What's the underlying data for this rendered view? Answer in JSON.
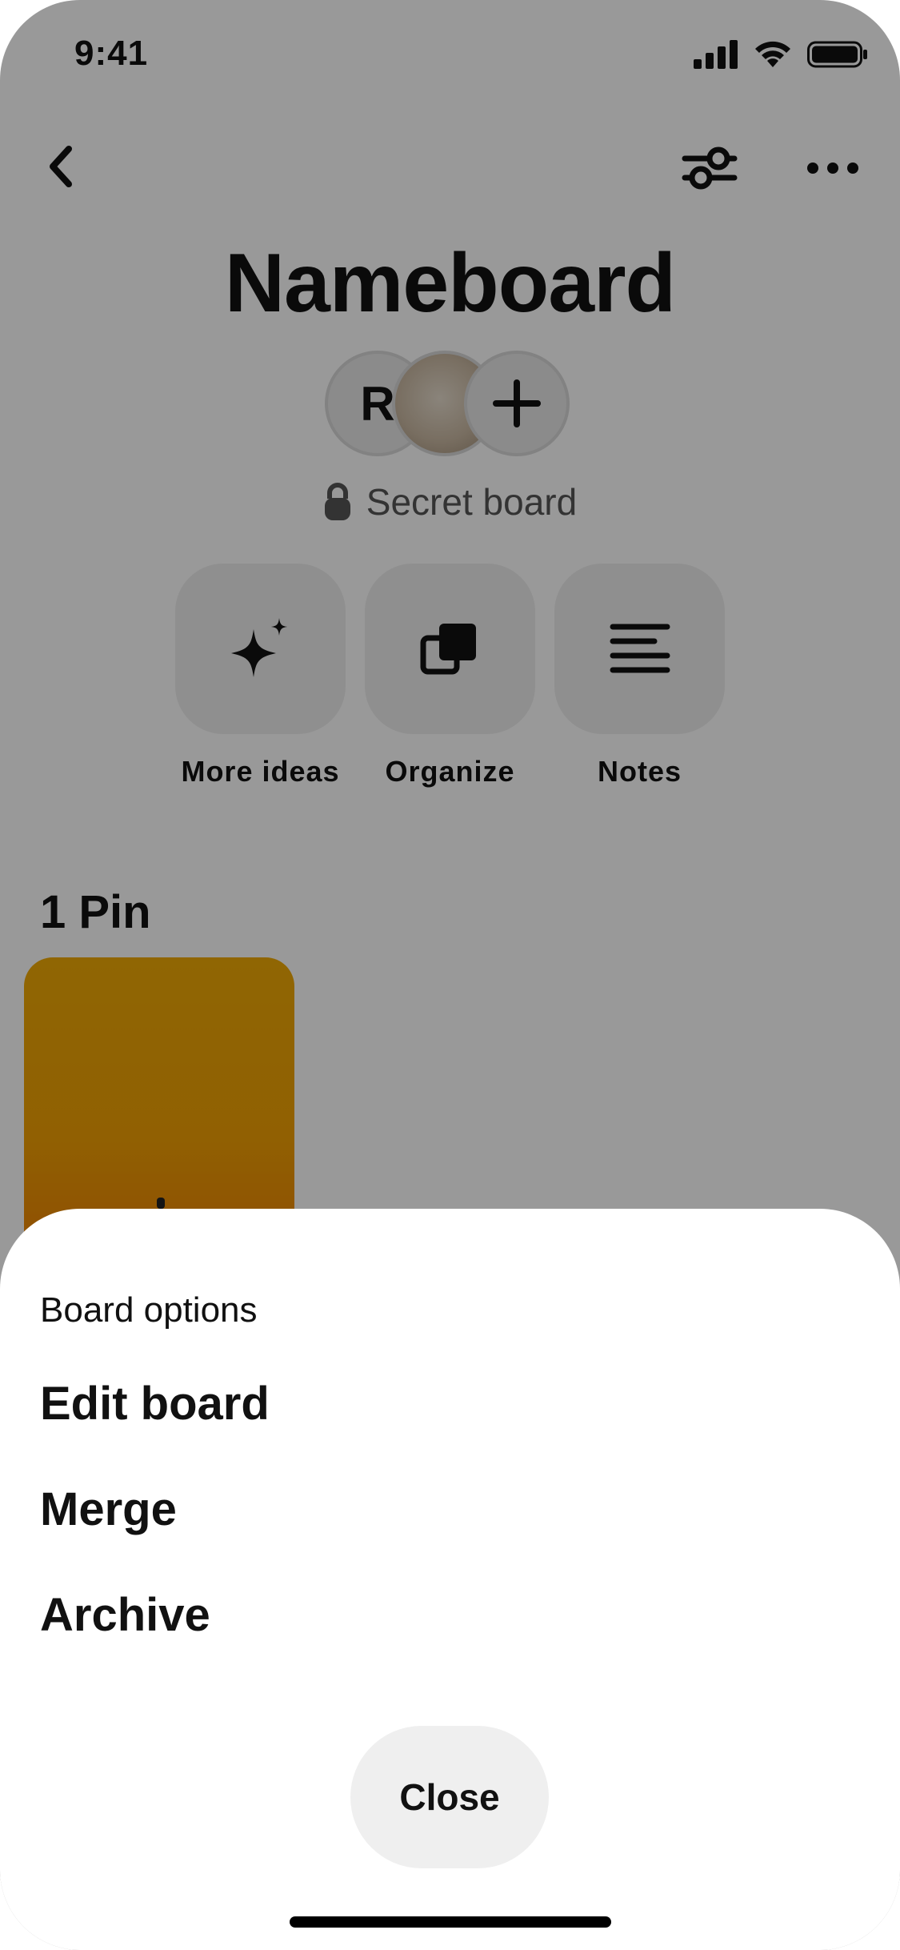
{
  "status_bar": {
    "time": "9:41"
  },
  "board": {
    "title": "Nameboard",
    "avatar_initial": "R",
    "privacy_label": "Secret board"
  },
  "actions": [
    {
      "label": "More ideas",
      "icon": "sparkle-icon"
    },
    {
      "label": "Organize",
      "icon": "organize-icon"
    },
    {
      "label": "Notes",
      "icon": "notes-icon"
    }
  ],
  "pins": {
    "count_label": "1 Pin"
  },
  "sheet": {
    "title": "Board options",
    "items": [
      "Edit board",
      "Merge",
      "Archive"
    ],
    "close_label": "Close"
  },
  "colors": {
    "overlay": "#000000",
    "tile_bg": "#efefef",
    "pin_gradient_top": "#f0aa06",
    "pin_gradient_bottom": "#e85d07"
  }
}
